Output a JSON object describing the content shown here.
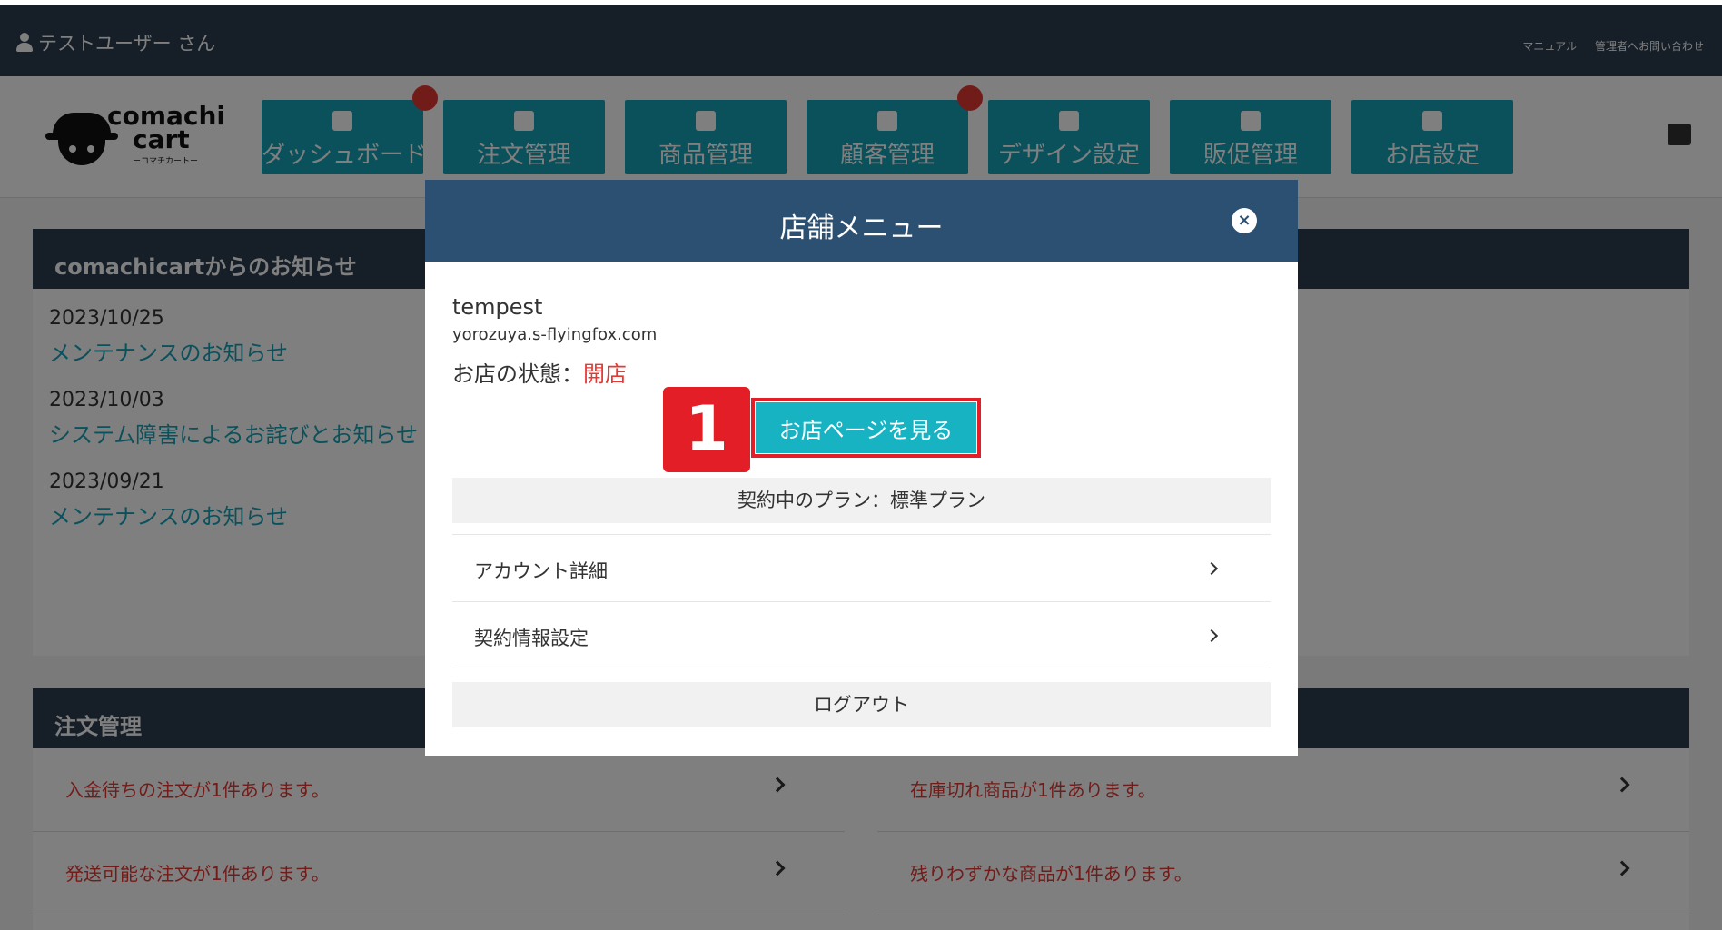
{
  "topbar": {
    "user_label": "テストユーザー さん",
    "links": [
      "マニュアル",
      "管理者へお問い合わせ"
    ]
  },
  "logo": {
    "line1": "comachi",
    "line2": "cart",
    "tagline": "ーコマチカートー"
  },
  "nav": [
    {
      "label": "ダッシュボード",
      "icon": "clipboard-icon",
      "badge": true
    },
    {
      "label": "注文管理",
      "icon": "cart-icon",
      "badge": false
    },
    {
      "label": "商品管理",
      "icon": "shirt-icon",
      "badge": false
    },
    {
      "label": "顧客管理",
      "icon": "user-icon",
      "badge": true
    },
    {
      "label": "デザイン設定",
      "icon": "palette-icon",
      "badge": false
    },
    {
      "label": "販促管理",
      "icon": "chart-icon",
      "badge": false
    },
    {
      "label": "お店設定",
      "icon": "store-icon",
      "badge": false
    }
  ],
  "news": {
    "title": "comachicartからのお知らせ",
    "items": [
      {
        "date": "2023/10/25",
        "title": "メンテナンスのお知らせ"
      },
      {
        "date": "2023/10/03",
        "title": "システム障害によるお詫びとお知らせ"
      },
      {
        "date": "2023/09/21",
        "title": "メンテナンスのお知らせ"
      }
    ]
  },
  "orders": {
    "title": "注文管理",
    "left": [
      "入金待ちの注文が1件あります。",
      "発送可能な注文が1件あります。"
    ],
    "right": [
      "在庫切れ商品が1件あります。",
      "残りわずかな商品が1件あります。"
    ]
  },
  "modal": {
    "title": "店舗メニュー",
    "close": "×",
    "shop_name": "tempest",
    "shop_domain": "yorozuya.s-flyingfox.com",
    "status_label": "お店の状態：",
    "status_value": "開店",
    "step": "1",
    "view_button": "お店ページを見る",
    "plan": "契約中のプラン：標準プラン",
    "menu": [
      "アカウント詳細",
      "契約情報設定"
    ],
    "logout": "ログアウト"
  },
  "colors": {
    "topbar": "#2c3e50",
    "accent": "#17a2b8",
    "modal_header": "#2c5072",
    "highlight": "#e41e26",
    "status_open": "#e53935"
  }
}
